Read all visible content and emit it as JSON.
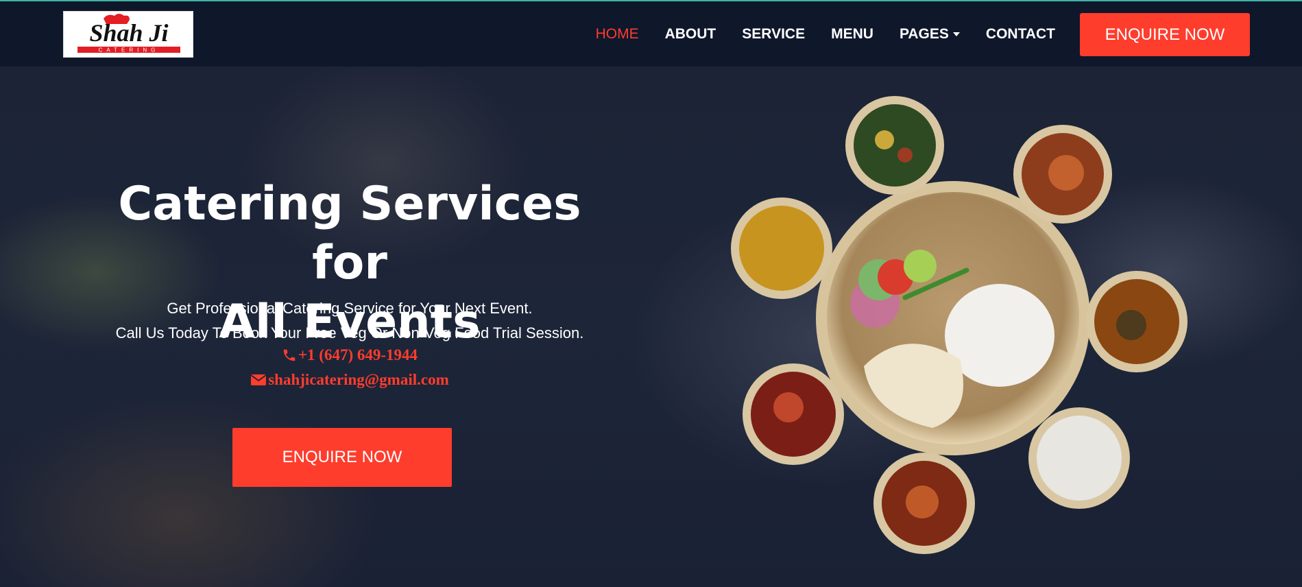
{
  "brand": {
    "logo_text": "Shah Ji",
    "logo_subtext": "CATERING"
  },
  "nav": {
    "items": [
      {
        "label": "HOME",
        "active": true
      },
      {
        "label": "ABOUT",
        "active": false
      },
      {
        "label": "SERVICE",
        "active": false
      },
      {
        "label": "MENU",
        "active": false
      },
      {
        "label": "PAGES",
        "active": false,
        "dropdown": true
      },
      {
        "label": "CONTACT",
        "active": false
      }
    ],
    "cta_label": "ENQUIRE NOW"
  },
  "hero": {
    "title_line1": "Catering Services for",
    "title_line2": "All Events",
    "subtitle_line1": "Get Professional Catering Service for Your Next Event.",
    "subtitle_line2": "Call Us Today To Book Your Free Veg Or Non-Veg Food Trial Session.",
    "phone": "+1 (647) 649-1944",
    "email": "shahjicatering@gmail.com",
    "cta_label": "ENQUIRE NOW"
  },
  "icons": {
    "phone": "phone-icon",
    "email": "envelope-icon",
    "dropdown": "caret-down-icon"
  },
  "colors": {
    "accent": "#fe3d2d",
    "navbar_bg": "#0f172b",
    "text": "#ffffff"
  }
}
